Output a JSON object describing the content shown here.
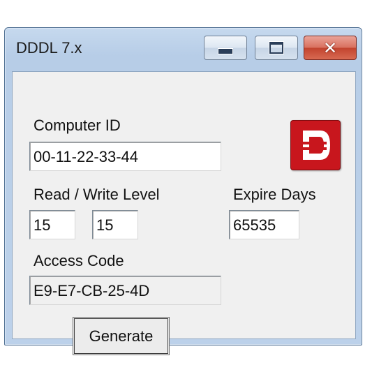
{
  "window": {
    "title": "DDDL 7.x",
    "title_icons": [
      "minimize-icon",
      "maximize-icon",
      "close-icon"
    ]
  },
  "form": {
    "computer_id_label": "Computer ID",
    "computer_id_value": "00-11-22-33-44",
    "rw_level_label": "Read / Write Level",
    "read_level_value": "15",
    "write_level_value": "15",
    "expire_days_label": "Expire Days",
    "expire_days_value": "65535",
    "access_code_label": "Access Code",
    "access_code_value": "E9-E7-CB-25-4D",
    "generate_label": "Generate"
  },
  "logo": {
    "icon": "dddl-logo-icon",
    "color": "#c8161d"
  },
  "colors": {
    "close_button": "#c2442f",
    "client_bg": "#f0f0f0",
    "frame": "#bcd1ea"
  }
}
